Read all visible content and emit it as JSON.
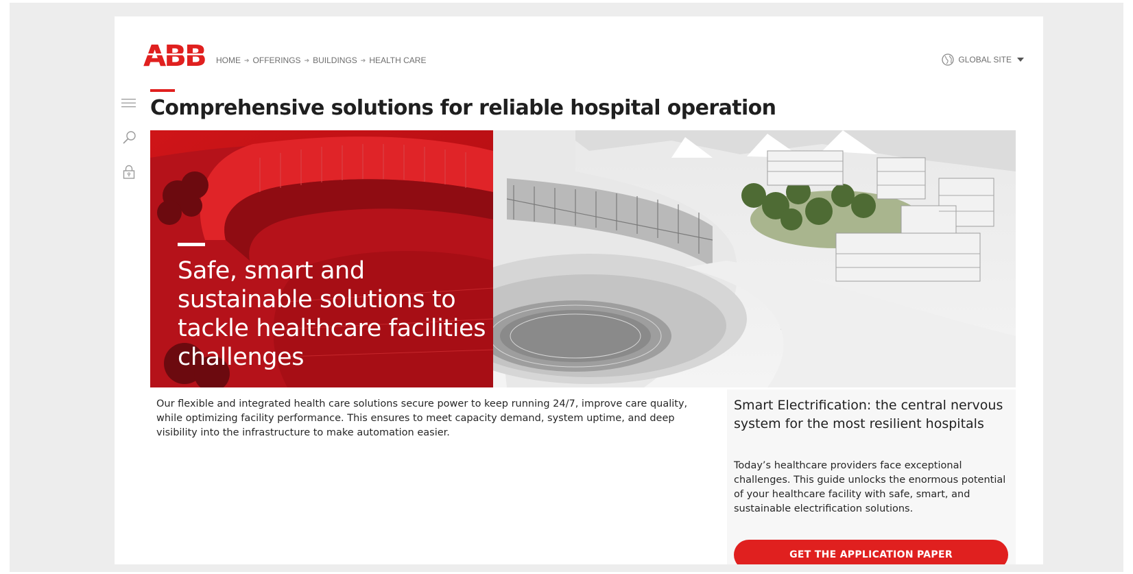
{
  "brand": {
    "logo_text": "ABB",
    "accent": "#e0201f"
  },
  "breadcrumb": [
    "HOME",
    "OFFERINGS",
    "BUILDINGS",
    "HEALTH CARE"
  ],
  "header": {
    "global_site": "GLOBAL SITE",
    "globe_icon": "globe-icon"
  },
  "sidetools": [
    {
      "icon": "menu-icon"
    },
    {
      "icon": "search-icon"
    },
    {
      "icon": "lock-icon"
    }
  ],
  "page": {
    "title": "Comprehensive solutions for reliable hospital operation"
  },
  "hero": {
    "headline": "Safe, smart and sustainable solutions to tackle healthcare facilities challenges",
    "image": "hospital-campus-rendering"
  },
  "intro": {
    "text": "Our flexible and integrated health care solutions secure power to keep running 24/7, improve care quality, while optimizing facility performance. This ensures to meet capacity demand, system uptime, and deep visibility into the infrastructure to make automation easier."
  },
  "card": {
    "title": "Smart Electrification: the central nervous system for the most resilient hospitals",
    "text": "Today’s healthcare providers face exceptional challenges. This guide unlocks the enormous potential of your healthcare facility with safe, smart, and sustainable electrification solutions.",
    "button_label": "GET THE APPLICATION PAPER"
  }
}
